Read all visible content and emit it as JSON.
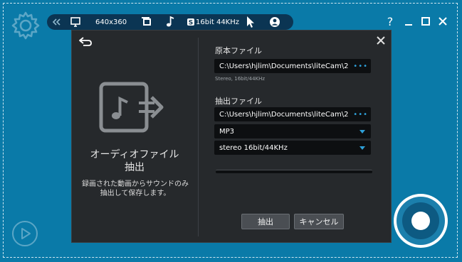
{
  "toolbar": {
    "resolution": "640x360",
    "audio_format": "16bit 44KHz"
  },
  "window_controls": {
    "help": "?"
  },
  "dialog": {
    "left_title": "オーディオファイル\n抽出",
    "left_description": "録画された動画からサウンドのみ\n抽出して保存します。",
    "source_label": "原本ファイル",
    "source_path": "C:\\Users\\hjlim\\Documents\\liteCam\\2",
    "source_info": "Stereo, 16bit/44KHz",
    "output_label": "抽出ファイル",
    "output_path": "C:\\Users\\hjlim\\Documents\\liteCam\\2",
    "format_selected": "MP3",
    "quality_selected": "stereo 16bit/44KHz",
    "progress": 0,
    "extract_button": "抽出",
    "cancel_button": "キャンセル"
  },
  "colors": {
    "background": "#0a7aa8",
    "dialog": "#26292c",
    "accent": "#2ea0d8"
  },
  "icons": [
    "gear-icon",
    "chevrons-left-icon",
    "monitor-icon",
    "fullscreen-icon",
    "music-note-icon",
    "s-badge-icon",
    "cursor-icon",
    "webcam-icon",
    "help-icon",
    "minimize-icon",
    "maximize-icon",
    "close-icon",
    "back-icon",
    "audio-file-extract-icon",
    "play-icon",
    "record-icon"
  ]
}
